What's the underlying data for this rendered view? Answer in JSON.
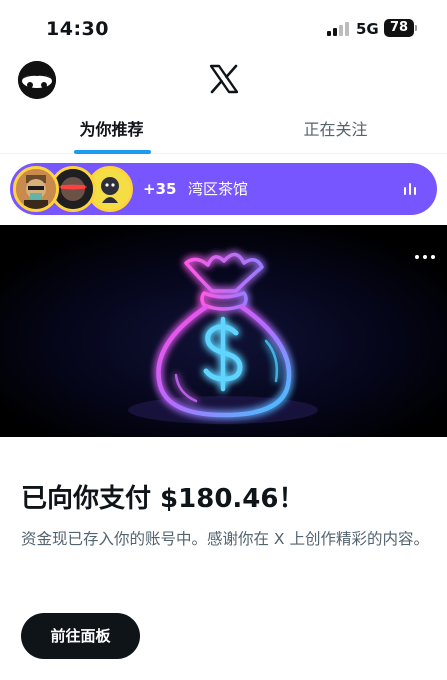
{
  "status_bar": {
    "time": "14:30",
    "network": "5G",
    "battery": "78"
  },
  "header": {
    "logo": "x-logo-icon",
    "avatar": "profile-avatar"
  },
  "tabs": [
    {
      "label": "为你推荐",
      "active": true
    },
    {
      "label": "正在关注",
      "active": false
    }
  ],
  "space": {
    "listener_count": "+35",
    "title": "湾区茶馆",
    "color": "#7856ff",
    "ring_color": "#ffd43b"
  },
  "payout": {
    "headline": "已向你支付 $180.46！",
    "description": "资金现已存入你的账号中。感谢你在 X 上创作精彩的内容。",
    "button_label": "前往面板"
  },
  "colors": {
    "accent": "#1d9bf0",
    "text_primary": "#0f1419",
    "text_secondary": "#536471"
  }
}
